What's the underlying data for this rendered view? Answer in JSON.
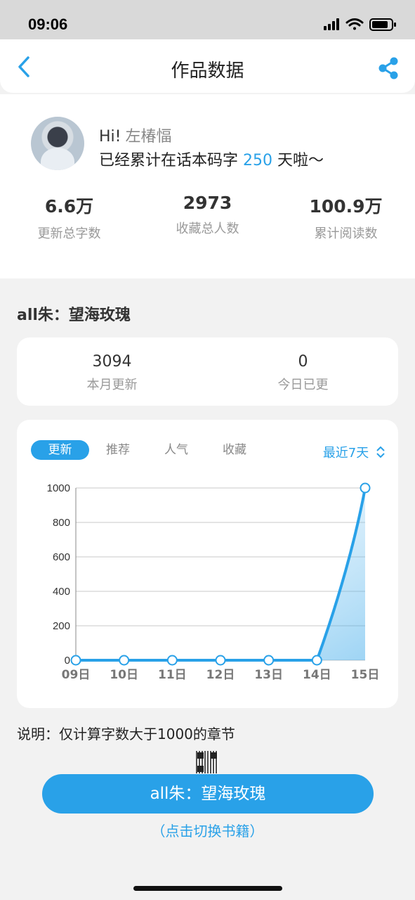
{
  "status": {
    "time": "09:06"
  },
  "nav": {
    "title": "作品数据",
    "back_icon": "chevron-left-icon",
    "share_icon": "share-icon"
  },
  "colors": {
    "accent": "#29a1e8"
  },
  "profile": {
    "greeting": "Hi!",
    "name": "左椿愊",
    "days_prefix": "已经累计在话本码字",
    "days": "250",
    "days_suffix": "天啦～",
    "stats": [
      {
        "value": "6.6万",
        "label": "更新总字数"
      },
      {
        "value": "2973",
        "label": "收藏总人数"
      },
      {
        "value": "100.9万",
        "label": "累计阅读数"
      }
    ]
  },
  "book": {
    "title": "all朱：望海玫瑰",
    "month_updates": {
      "value": "3094",
      "label": "本月更新"
    },
    "today_updates": {
      "value": "0",
      "label": "今日已更"
    }
  },
  "chart_tabs": [
    "更新",
    "推荐",
    "人气",
    "收藏"
  ],
  "active_tab": "更新",
  "range": "最近7天",
  "chart_data": {
    "type": "area",
    "categories": [
      "09日",
      "10日",
      "11日",
      "12日",
      "13日",
      "14日",
      "15日"
    ],
    "values": [
      0,
      0,
      0,
      0,
      0,
      0,
      1000
    ],
    "yticks": [
      0,
      200,
      400,
      600,
      800,
      1000
    ],
    "ylim": [
      0,
      1000
    ],
    "grid": true
  },
  "note": "说明：仅计算字数大于1000的章节",
  "switch_button": "all朱：望海玫瑰",
  "switch_hint": "（点击切换书籍）"
}
